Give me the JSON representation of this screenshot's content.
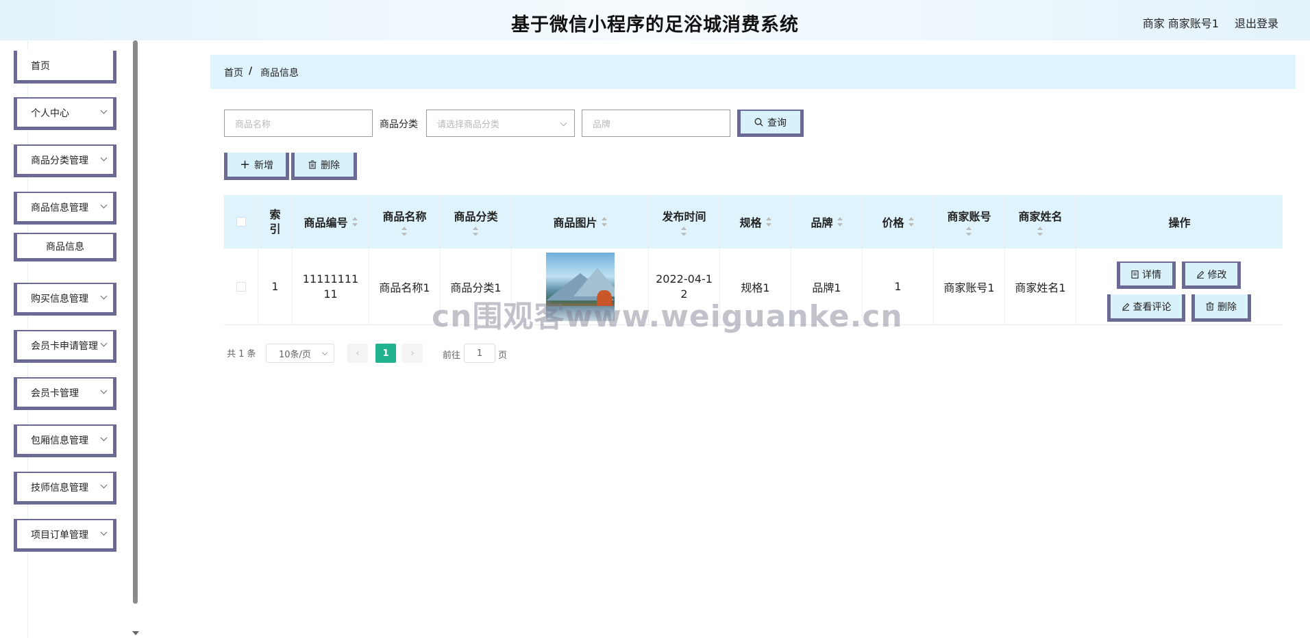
{
  "header": {
    "title": "基于微信小程序的足浴城消费系统",
    "user": "商家 商家账号1",
    "logout": "退出登录"
  },
  "sidebar": {
    "items": [
      {
        "label": "首页",
        "expandable": false
      },
      {
        "label": "个人中心",
        "expandable": true
      },
      {
        "label": "商品分类管理",
        "expandable": true
      },
      {
        "label": "商品信息管理",
        "expandable": true
      },
      {
        "label": "商品信息",
        "expandable": false,
        "submenu": true
      },
      {
        "label": "购买信息管理",
        "expandable": true
      },
      {
        "label": "会员卡申请管理",
        "expandable": true
      },
      {
        "label": "会员卡管理",
        "expandable": true
      },
      {
        "label": "包厢信息管理",
        "expandable": true
      },
      {
        "label": "技师信息管理",
        "expandable": true
      },
      {
        "label": "项目订单管理",
        "expandable": true
      }
    ]
  },
  "breadcrumb": {
    "home": "首页",
    "separator": "/",
    "current": "商品信息"
  },
  "search": {
    "name_placeholder": "商品名称",
    "category_label": "商品分类",
    "category_placeholder": "请选择商品分类",
    "brand_placeholder": "品牌",
    "query_label": "查询"
  },
  "actions": {
    "add_label": "新增",
    "delete_label": "删除"
  },
  "table": {
    "headers": {
      "index": "索引",
      "code": "商品编号",
      "name": "商品名称",
      "category": "商品分类",
      "image": "商品图片",
      "time": "发布时间",
      "spec": "规格",
      "brand": "品牌",
      "price": "价格",
      "account": "商家账号",
      "merchant": "商家姓名",
      "ops": "操作"
    },
    "rows": [
      {
        "index": "1",
        "code": "1111111111",
        "name": "商品名称1",
        "category": "商品分类1",
        "time": "2022-04-12",
        "spec": "规格1",
        "brand": "品牌1",
        "price": "1",
        "account": "商家账号1",
        "merchant": "商家姓名1",
        "ops": {
          "detail": "详情",
          "edit": "修改",
          "review": "查看评论",
          "delete": "删除"
        }
      }
    ]
  },
  "pagination": {
    "total": "共 1 条",
    "page_size": "10条/页",
    "current_page": "1",
    "goto_prefix": "前往",
    "goto_value": "1",
    "goto_suffix": "页"
  },
  "watermark": "cn围观客www.weiguanke.cn",
  "colors": {
    "header_bg": "#e3f2fb",
    "accent_border": "#6a6a94",
    "button_bg": "#d9f1fb",
    "pager_active": "#21b38f"
  }
}
